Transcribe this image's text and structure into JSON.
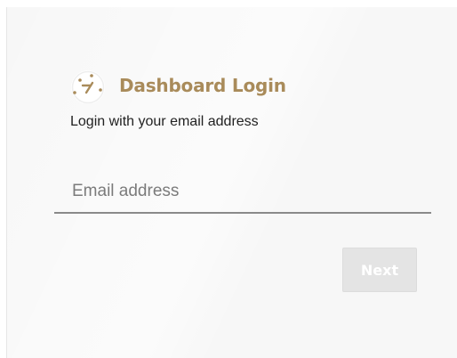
{
  "header": {
    "title": "Dashboard Login",
    "icon": "gauge-icon"
  },
  "subtitle": "Login with your email address",
  "email": {
    "value": "",
    "placeholder": "Email address"
  },
  "next_button": {
    "label": "Next",
    "state": "disabled"
  },
  "colors": {
    "brand": "#a98b5a",
    "background": "#f7f7f7",
    "button_disabled": "#e4e4e4",
    "input_underline": "#8a8a8a"
  }
}
